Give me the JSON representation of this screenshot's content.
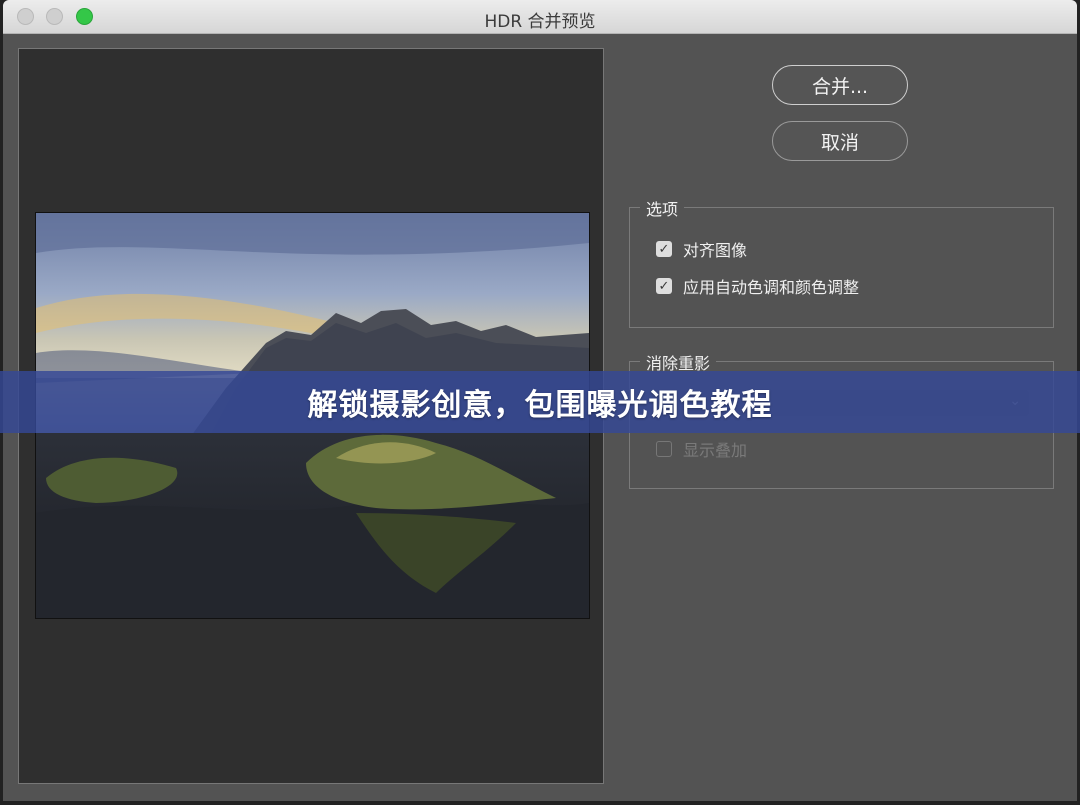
{
  "window": {
    "title": "HDR 合并预览"
  },
  "buttons": {
    "merge": "合并...",
    "cancel": "取消"
  },
  "options": {
    "title": "选项",
    "align_images": {
      "label": "对齐图像",
      "checked": true
    },
    "auto_tone": {
      "label": "应用自动色调和颜色调整",
      "checked": true
    }
  },
  "ghost_removal": {
    "title": "消除重影",
    "show_overlay": {
      "label": "显示叠加",
      "checked": false
    }
  },
  "banner": {
    "text": "解锁摄影创意，包围曝光调色教程"
  },
  "icons": {
    "check": "✓",
    "chevron": "⌄"
  },
  "colors": {
    "zoom": "#34c748",
    "banner": "#344896",
    "panel": "#535353"
  }
}
